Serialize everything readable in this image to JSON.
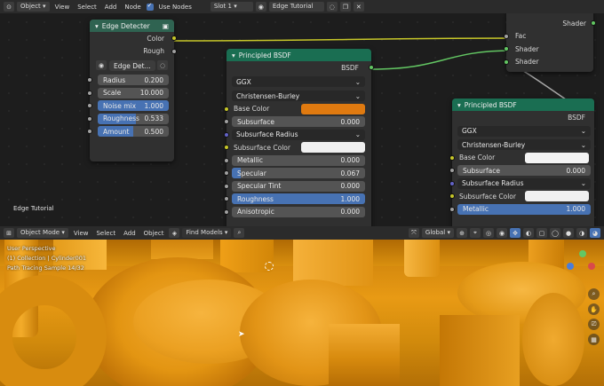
{
  "node_header": {
    "mode": "Object",
    "menus": [
      "View",
      "Select",
      "Add",
      "Node"
    ],
    "use_nodes_label": "Use Nodes",
    "slot": "Slot 1",
    "material": "Edge Tutorial"
  },
  "edge_node": {
    "title": "Edge Detecter",
    "outputs": [
      "Color",
      "Rough"
    ],
    "datablock": "Edge Det...",
    "params": [
      {
        "label": "Radius",
        "value": "0.200",
        "highlight": false
      },
      {
        "label": "Scale",
        "value": "10.000",
        "highlight": false
      },
      {
        "label": "Noise mix",
        "value": "1.000",
        "highlight": true
      },
      {
        "label": "Roughness",
        "value": "0.533",
        "highlight": true,
        "fraction": 0.533
      },
      {
        "label": "Amount",
        "value": "0.500",
        "highlight": true,
        "fraction": 0.5
      }
    ]
  },
  "bsdf1": {
    "title": "Principled BSDF",
    "output": "BSDF",
    "distribution": "GGX",
    "subsurface_method": "Christensen-Burley",
    "base_color_label": "Base Color",
    "base_color": "#e07a10",
    "subsurface_label": "Subsurface",
    "subsurface_value": "0.000",
    "subsurface_radius_label": "Subsurface Radius",
    "subsurface_color_label": "Subsurface Color",
    "metallic_label": "Metallic",
    "metallic_value": "0.000",
    "specular_label": "Specular",
    "specular_value": "0.067",
    "specular_fraction": 0.067,
    "specular_tint_label": "Specular Tint",
    "specular_tint_value": "0.000",
    "roughness_label": "Roughness",
    "roughness_value": "1.000",
    "anisotropic_label": "Anisotropic",
    "anisotropic_value": "0.000"
  },
  "bsdf2": {
    "title": "Principled BSDF",
    "output": "BSDF",
    "distribution": "GGX",
    "subsurface_method": "Christensen-Burley",
    "base_color_label": "Base Color",
    "subsurface_label": "Subsurface",
    "subsurface_value": "0.000",
    "subsurface_radius_label": "Subsurface Radius",
    "subsurface_color_label": "Subsurface Color",
    "metallic_label": "Metallic",
    "metallic_value": "1.000"
  },
  "mix_node": {
    "output": "Shader",
    "inputs": [
      "Fac",
      "Shader",
      "Shader"
    ]
  },
  "editor_label": "Edge Tutorial",
  "viewport_header": {
    "mode": "Object Mode",
    "menus": [
      "View",
      "Select",
      "Add",
      "Object"
    ],
    "find": "Find Models",
    "transform": "Global"
  },
  "viewport_info": {
    "perspective": "User Perspective",
    "collection": "(1) Collection | Cylinder001",
    "sample": "Path Tracing Sample 14/32"
  },
  "colors": {
    "node_green": "#1a6e52",
    "accent_blue": "#4772b3",
    "render_orange": "#e89a14"
  }
}
